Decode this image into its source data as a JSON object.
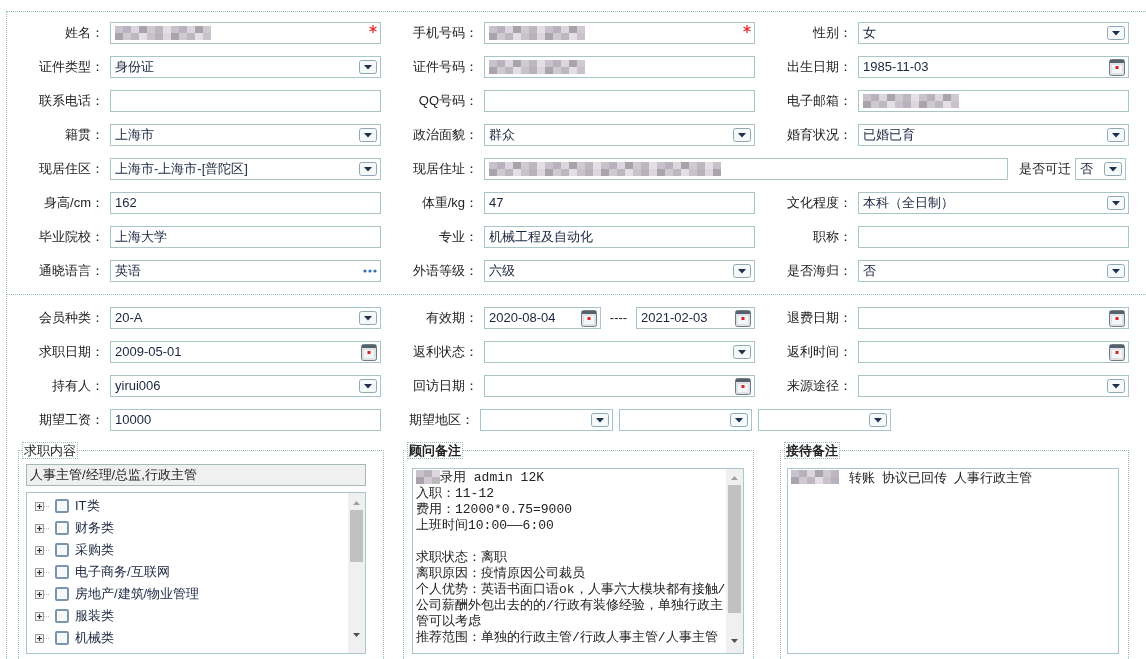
{
  "basic_info": {
    "rows": [
      [
        {
          "label": "姓名：",
          "kind": "redacted",
          "required": true
        },
        {
          "label": "手机号码：",
          "kind": "redacted",
          "required": true
        },
        {
          "label": "性别：",
          "kind": "select",
          "value": "女"
        }
      ],
      [
        {
          "label": "证件类型：",
          "kind": "select",
          "value": "身份证"
        },
        {
          "label": "证件号码：",
          "kind": "redacted"
        },
        {
          "label": "出生日期：",
          "kind": "date",
          "value": "1985-11-03"
        }
      ],
      [
        {
          "label": "联系电话：",
          "kind": "text"
        },
        {
          "label": "QQ号码：",
          "kind": "text"
        },
        {
          "label": "电子邮箱：",
          "kind": "redacted"
        }
      ],
      [
        {
          "label": "籍贯：",
          "kind": "select",
          "value": "上海市"
        },
        {
          "label": "政治面貌：",
          "kind": "select",
          "value": "群众"
        },
        {
          "label": "婚育状况：",
          "kind": "select",
          "value": "已婚已育"
        }
      ],
      [
        {
          "label": "现居住区：",
          "kind": "select",
          "value": "上海市-上海市-[普陀区]"
        },
        {
          "label": "现居住址：",
          "kind": "redacted",
          "attached": {
            "label": "是否可迁",
            "kind": "select",
            "value": "否"
          }
        }
      ],
      [
        {
          "label": "身高/cm：",
          "kind": "text",
          "value": "162"
        },
        {
          "label": "体重/kg：",
          "kind": "text",
          "value": "47"
        },
        {
          "label": "文化程度：",
          "kind": "select",
          "value": "本科（全日制）"
        }
      ],
      [
        {
          "label": "毕业院校：",
          "kind": "text",
          "value": "上海大学"
        },
        {
          "label": "专业：",
          "kind": "text",
          "value": "机械工程及自动化"
        },
        {
          "label": "职称：",
          "kind": "text"
        }
      ],
      [
        {
          "label": "通晓语言：",
          "kind": "picker",
          "value": "英语"
        },
        {
          "label": "外语等级：",
          "kind": "select",
          "value": "六级"
        },
        {
          "label": "是否海归：",
          "kind": "select",
          "value": "否"
        }
      ]
    ]
  },
  "membership": {
    "rows": [
      [
        {
          "label": "会员种类：",
          "kind": "select",
          "value": "20-A"
        },
        {
          "label": "有效期：",
          "kind": "date_range",
          "from": "2020-08-04",
          "separator": "----",
          "to": "2021-02-03"
        },
        {
          "label": "退费日期：",
          "kind": "date"
        }
      ],
      [
        {
          "label": "求职日期：",
          "kind": "date",
          "value": "2009-05-01"
        },
        {
          "label": "返利状态：",
          "kind": "select"
        },
        {
          "label": "返利时间：",
          "kind": "date"
        }
      ],
      [
        {
          "label": "持有人：",
          "kind": "select",
          "value": "yirui006"
        },
        {
          "label": "回访日期：",
          "kind": "date"
        },
        {
          "label": "来源途径：",
          "kind": "select"
        }
      ],
      [
        {
          "label": "期望工资：",
          "kind": "text",
          "value": "10000"
        },
        {
          "label": "期望地区：",
          "kind": "multi_select",
          "parts": [
            {
              "kind": "select"
            },
            {
              "kind": "select"
            },
            {
              "kind": "select"
            }
          ]
        }
      ]
    ]
  },
  "job_content": {
    "legend": "求职内容",
    "selected_text": "人事主管/经理/总监,行政主管",
    "tree": [
      {
        "label": "IT类",
        "expanded": false,
        "checked": false
      },
      {
        "label": "财务类",
        "expanded": false,
        "checked": false
      },
      {
        "label": "采购类",
        "expanded": false,
        "checked": false
      },
      {
        "label": "电子商务/互联网",
        "expanded": false,
        "checked": false
      },
      {
        "label": "房地产/建筑/物业管理",
        "expanded": false,
        "checked": false
      },
      {
        "label": "服装类",
        "expanded": false,
        "checked": false
      },
      {
        "label": "机械类",
        "expanded": false,
        "checked": false
      }
    ]
  },
  "consultant_notes": {
    "legend": "顾问备注",
    "paragraphs": [
      [
        {
          "text": "录用 admin 12K",
          "redacted_prefix": true
        },
        {
          "text": "入职：11-12"
        },
        {
          "text": "费用：12000*0.75=9000"
        },
        {
          "text": "上班时间10:00——6:00"
        }
      ],
      [
        {
          "text": "求职状态：离职"
        },
        {
          "text": "离职原因：疫情原因公司裁员"
        },
        {
          "text": "个人优势：英语书面口语ok，人事六大模块都有接触/公司薪酬外包出去的的/行政有装修经验，单独行政主管可以考虑"
        },
        {
          "text": "推荐范围：单独的行政主管/行政人事主管/人事主管"
        }
      ]
    ]
  },
  "reception_notes": {
    "legend": "接待备注",
    "paragraphs": [
      [
        {
          "text": "转账  协议已回传  人事行政主管",
          "redacted_prefix": true
        }
      ]
    ]
  }
}
